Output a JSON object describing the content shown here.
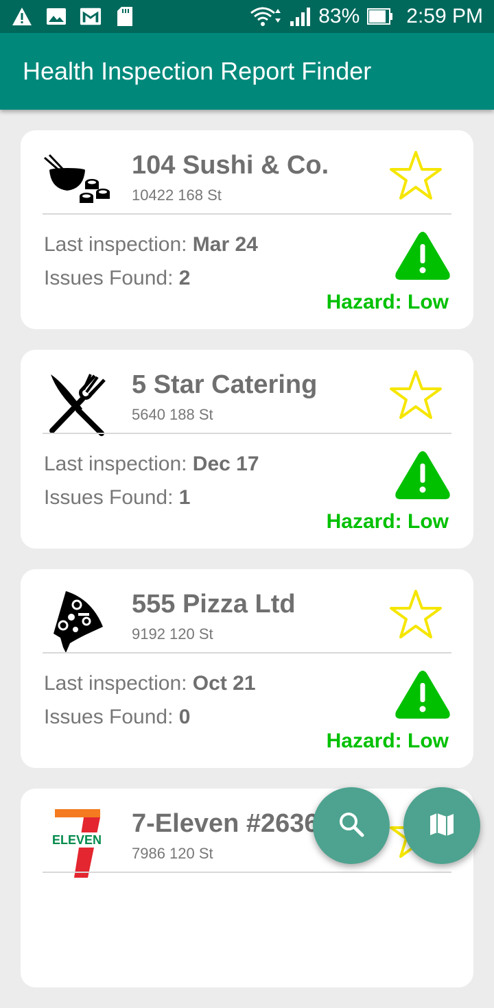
{
  "status_bar": {
    "battery": "83%",
    "time": "2:59 PM",
    "icons": [
      "warning-icon",
      "image-icon",
      "gmail-icon",
      "sd-card-icon",
      "wifi-icon",
      "signal-icon",
      "battery-icon"
    ]
  },
  "app_bar": {
    "title": "Health Inspection Report Finder"
  },
  "labels": {
    "last_inspection": "Last inspection: ",
    "issues_found": "Issues Found: "
  },
  "restaurants": [
    {
      "name": "104 Sushi & Co.",
      "address": "10422 168 St",
      "last_inspection": "Mar 24",
      "issues": "2",
      "hazard": "Hazard: Low",
      "icon": "sushi-icon"
    },
    {
      "name": "5 Star Catering",
      "address": "5640 188 St",
      "last_inspection": "Dec 17",
      "issues": "1",
      "hazard": "Hazard: Low",
      "icon": "cutlery-icon"
    },
    {
      "name": "555 Pizza Ltd",
      "address": "9192 120 St",
      "last_inspection": "Oct 21",
      "issues": "0",
      "hazard": "Hazard: Low",
      "icon": "pizza-icon"
    },
    {
      "name": "7-Eleven #2636",
      "address": "7986 120 St",
      "icon": "seven-eleven-logo"
    }
  ],
  "fabs": {
    "search": "search-icon",
    "map": "map-icon"
  },
  "colors": {
    "status_bar": "#00695c",
    "app_bar": "#00897b",
    "hazard_low": "#00c000",
    "star": "#f5e600",
    "fab": "#4da38f"
  }
}
